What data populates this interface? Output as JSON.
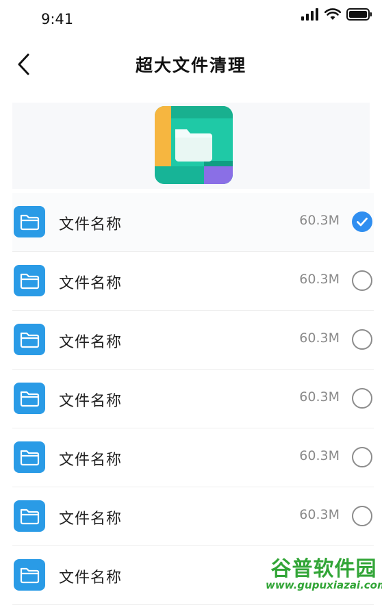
{
  "status_bar": {
    "time": "9:41",
    "icons": [
      "signal-icon",
      "wifi-icon",
      "battery-icon"
    ]
  },
  "header": {
    "title": "超大文件清理",
    "back_icon": "chevron-left-icon"
  },
  "hero": {
    "icon": "folder-app-icon"
  },
  "colors": {
    "accent": "#2f8ef0",
    "folder": "#2a9be6",
    "watermark": "#2aa22f"
  },
  "files": [
    {
      "name": "文件名称",
      "size": "60.3M",
      "selected": true
    },
    {
      "name": "文件名称",
      "size": "60.3M",
      "selected": false
    },
    {
      "name": "文件名称",
      "size": "60.3M",
      "selected": false
    },
    {
      "name": "文件名称",
      "size": "60.3M",
      "selected": false
    },
    {
      "name": "文件名称",
      "size": "60.3M",
      "selected": false
    },
    {
      "name": "文件名称",
      "size": "60.3M",
      "selected": false
    },
    {
      "name": "文件名称",
      "size": "",
      "selected": false
    }
  ],
  "watermark": {
    "title": "谷普软件园",
    "url": "www.gupuxiazai.com"
  }
}
